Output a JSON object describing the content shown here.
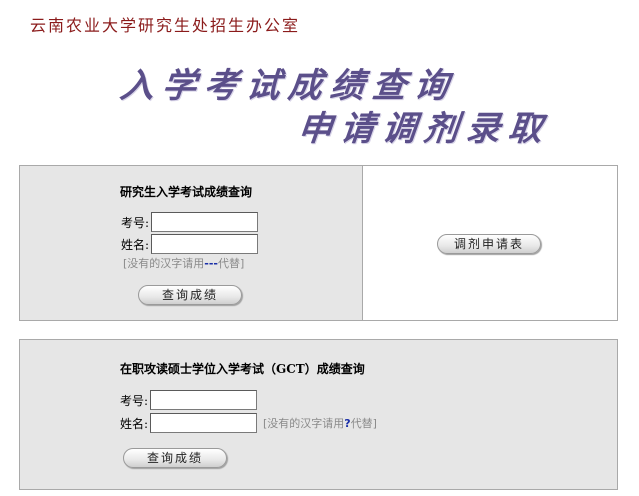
{
  "header": {
    "org_title": "云南农业大学研究生处招生办公室",
    "banner_line1": "入学考试成绩查询",
    "banner_line2": "申请调剂录取"
  },
  "grad_score_query": {
    "heading": "研究生入学考试成绩查询",
    "exam_no_label": "考号:",
    "exam_no_value": "",
    "name_label": "姓名:",
    "name_value": "",
    "hint_prefix": "[没有的汉字请用",
    "hint_symbol": "---",
    "hint_suffix": "代替]",
    "submit_label": "查询成绩"
  },
  "adjustment": {
    "button_label": "调剂申请表"
  },
  "gct_score_query": {
    "heading": "在职攻读硕士学位入学考试（GCT）成绩查询",
    "exam_no_label": "考号:",
    "exam_no_value": "",
    "name_label": "姓名:",
    "name_value": "",
    "hint_prefix": "[没有的汉字请用",
    "hint_symbol": "?",
    "hint_suffix": "代替]",
    "submit_label": "查询成绩"
  }
}
